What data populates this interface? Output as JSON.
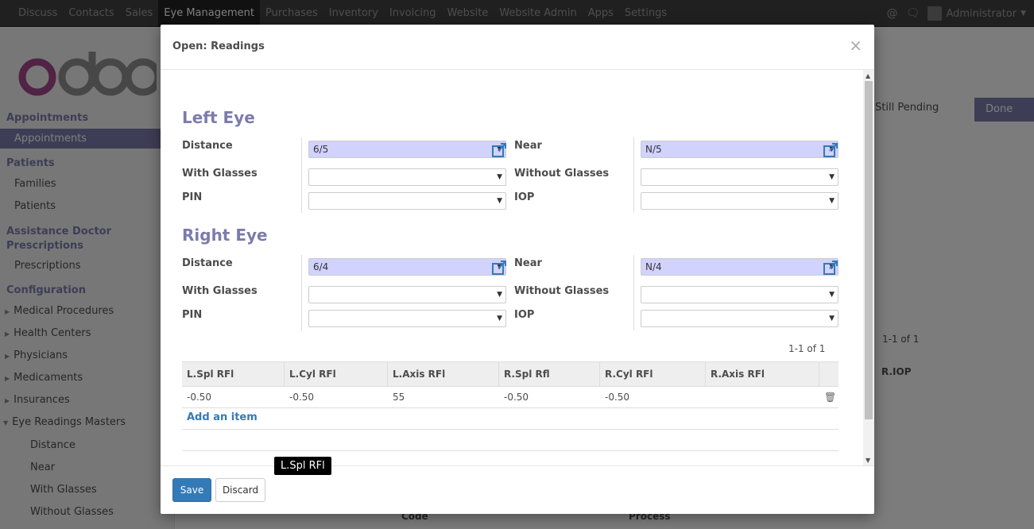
{
  "navbar": {
    "menus": [
      "Discuss",
      "Contacts",
      "Sales",
      "Eye Management",
      "Purchases",
      "Inventory",
      "Invoicing",
      "Website",
      "Website Admin",
      "Apps",
      "Settings"
    ],
    "active_index": 3,
    "user": "Administrator"
  },
  "sidebar": {
    "sections": [
      {
        "title": "Appointments",
        "items": [
          "Appointments"
        ]
      },
      {
        "title": "Patients",
        "items": [
          "Families",
          "Patients"
        ]
      },
      {
        "title": "Assistance Doctor Prescriptions",
        "items": [
          "Prescriptions"
        ]
      },
      {
        "title": "Configuration",
        "items": [
          "Medical Procedures",
          "Health Centers",
          "Physicians",
          "Medicaments",
          "Insurances",
          "Eye Readings Masters"
        ]
      }
    ],
    "sub_items": [
      "Distance",
      "Near",
      "With Glasses",
      "Without Glasses"
    ],
    "active_item": "Appointments"
  },
  "background": {
    "stages": [
      "Still Pending",
      "Done"
    ],
    "pager": "1-1 of 1",
    "col_riop": "R.IOP",
    "col_code": "Code",
    "col_process": "Process"
  },
  "modal": {
    "title": "Open: Readings",
    "close": "×",
    "left_eye": {
      "title": "Left Eye",
      "distance_label": "Distance",
      "distance_value": "6/5",
      "near_label": "Near",
      "near_value": "N/5",
      "with_glasses_label": "With Glasses",
      "without_glasses_label": "Without Glasses",
      "pin_label": "PIN",
      "iop_label": "IOP"
    },
    "right_eye": {
      "title": "Right Eye",
      "distance_label": "Distance",
      "distance_value": "6/4",
      "near_label": "Near",
      "near_value": "N/4",
      "with_glasses_label": "With Glasses",
      "without_glasses_label": "Without Glasses",
      "pin_label": "PIN",
      "iop_label": "IOP"
    },
    "pager": "1-1 of 1",
    "table": {
      "headers": [
        "L.Spl RFl",
        "L.Cyl RFl",
        "L.Axis RFl",
        "R.Spl Rfl",
        "R.Cyl RFl",
        "R.Axis RFl"
      ],
      "rows": [
        [
          "-0.50",
          "-0.50",
          "55",
          "-0.50",
          "-0.50",
          ""
        ]
      ]
    },
    "add_item": "Add an item",
    "save": "Save",
    "discard": "Discard"
  },
  "tooltip": "L.Spl RFl",
  "colors": {
    "accent": "#7c7bad",
    "primary": "#337ab7",
    "filled": "#d2d2ff"
  }
}
